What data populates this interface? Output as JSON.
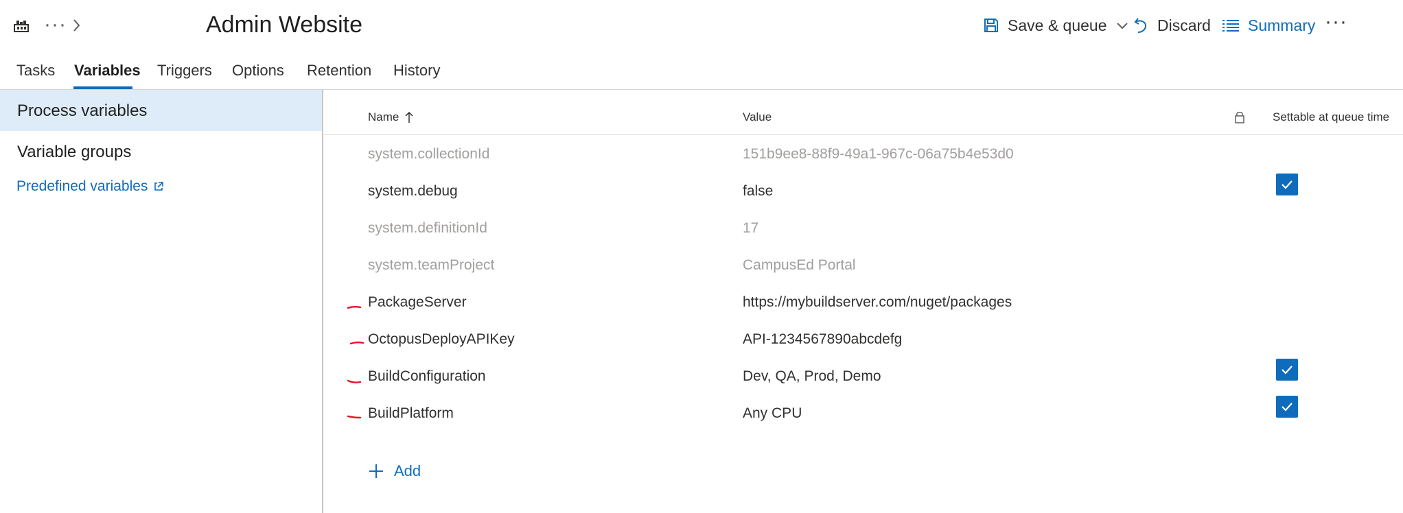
{
  "header": {
    "title": "Admin Website",
    "more_label": "···",
    "actions": {
      "save": "Save & queue",
      "discard": "Discard",
      "summary": "Summary",
      "more": "···"
    }
  },
  "tabs": [
    {
      "label": "Tasks",
      "active": false
    },
    {
      "label": "Variables",
      "active": true
    },
    {
      "label": "Triggers",
      "active": false
    },
    {
      "label": "Options",
      "active": false
    },
    {
      "label": "Retention",
      "active": false
    },
    {
      "label": "History",
      "active": false
    }
  ],
  "sidebar": {
    "items": [
      {
        "label": "Process variables",
        "selected": true
      },
      {
        "label": "Variable groups",
        "selected": false
      }
    ],
    "link": "Predefined variables"
  },
  "grid": {
    "columns": {
      "name": "Name",
      "value": "Value",
      "settable": "Settable at queue time"
    },
    "rows": [
      {
        "name": "system.collectionId",
        "value": "151b9ee8-88f9-49a1-967c-06a75b4e53d0",
        "system": true,
        "settable": false
      },
      {
        "name": "system.debug",
        "value": "false",
        "system": false,
        "settable": true
      },
      {
        "name": "system.definitionId",
        "value": "17",
        "system": true,
        "settable": false
      },
      {
        "name": "system.teamProject",
        "value": "CampusEd Portal",
        "system": true,
        "settable": false
      },
      {
        "name": "PackageServer",
        "value": "https://mybuildserver.com/nuget/packages",
        "system": false,
        "settable": false,
        "marked": true
      },
      {
        "name": "OctopusDeployAPIKey",
        "value": "API-1234567890abcdefg",
        "system": false,
        "settable": false,
        "marked": true
      },
      {
        "name": "BuildConfiguration",
        "value": "Dev, QA, Prod, Demo",
        "system": false,
        "settable": true,
        "marked": true
      },
      {
        "name": "BuildPlatform",
        "value": "Any CPU",
        "system": false,
        "settable": true,
        "marked": true
      }
    ],
    "add_label": "Add"
  },
  "colors": {
    "accent": "#0f6cbd",
    "selected_bg": "#deecf9",
    "muted_text": "#a19f9d",
    "annotation_red": "#e81123"
  }
}
